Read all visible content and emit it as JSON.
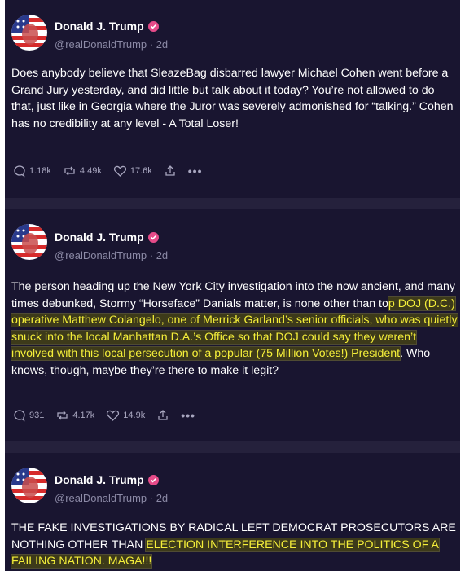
{
  "posts": [
    {
      "author": "Donald J. Trump",
      "handle": "@realDonaldTrump · 2d",
      "text_plain": "Does anybody believe that SleazeBag disbarred lawyer Michael Cohen went before a Grand Jury yesterday, and did little but talk about it today? You’re not allowed to do that, just like in Georgia where the Juror was severely admonished for “talking.” Cohen has no credibility at any level -  A Total Loser!",
      "replies": "1.18k",
      "reposts": "4.49k",
      "likes": "17.6k"
    },
    {
      "author": "Donald J. Trump",
      "handle": "@realDonaldTrump · 2d",
      "text_before": "The person heading up the New York City investigation into the now ancient, and many times debunked, Stormy “Horseface” Danials matter, is none other than to",
      "text_highlight": "p DOJ (D.C.) operative Matthew  Colangelo, one of Merrick Garland’s senior officials, who was quietly snuck into the local Manhattan D.A.’s Office so that DOJ could say they weren’t involved with this local persecution of a popular (75 Million Votes!) President",
      "text_after": ". Who knows, though, maybe they’re there to make it legit?",
      "replies": "931",
      "reposts": "4.17k",
      "likes": "14.9k"
    },
    {
      "author": "Donald J. Trump",
      "handle": "@realDonaldTrump · 2d",
      "text_before": "THE FAKE INVESTIGATIONS BY RADICAL LEFT DEMOCRAT PROSECUTORS ARE NOTHING OTHER THAN ",
      "text_highlight": "ELECTION INTERFERENCE INTO THE POLITICS OF A FAILING NATION. MAGA!!!"
    }
  ],
  "colors": {
    "background": "#191530",
    "separator": "#25213c",
    "verified": "#e64b89",
    "highlight_text": "#f5ef3a",
    "muted": "#8c8aa6"
  },
  "icons": [
    "comment-icon",
    "repost-icon",
    "heart-icon",
    "share-icon",
    "more-icon",
    "verified-icon"
  ]
}
